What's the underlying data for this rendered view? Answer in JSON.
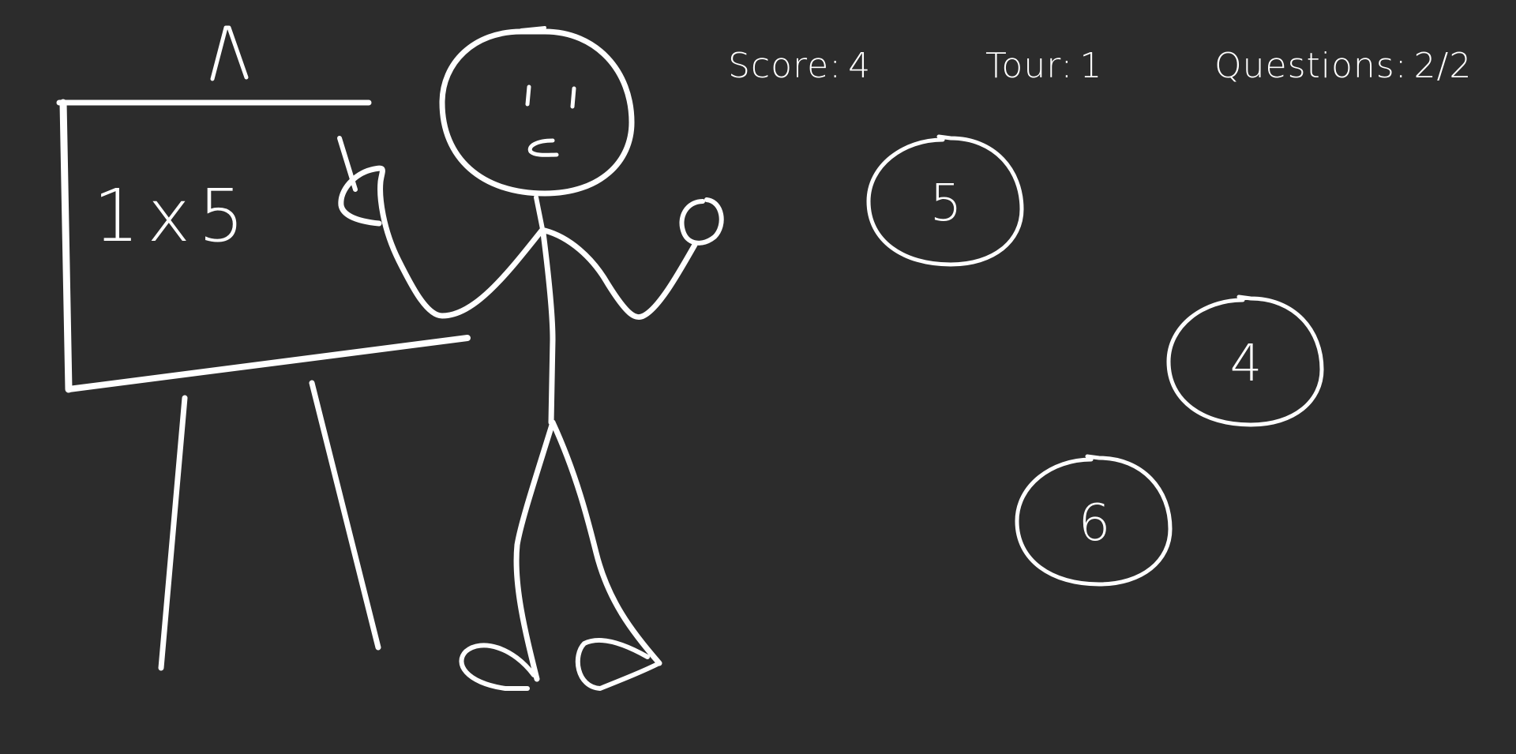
{
  "hud": {
    "score_label": "Score:",
    "score_value": "4",
    "round_label": "Tour:",
    "round_value": "1",
    "questions_label": "Questions:",
    "questions_value": "2/2"
  },
  "board": {
    "question": "1x5"
  },
  "answers": [
    "5",
    "4",
    "6"
  ],
  "colors": {
    "background": "#2c2c2c",
    "chalk": "#ffffff"
  },
  "icons": [
    "chalkboard-easel-icon",
    "stick-figure-teacher-icon"
  ]
}
